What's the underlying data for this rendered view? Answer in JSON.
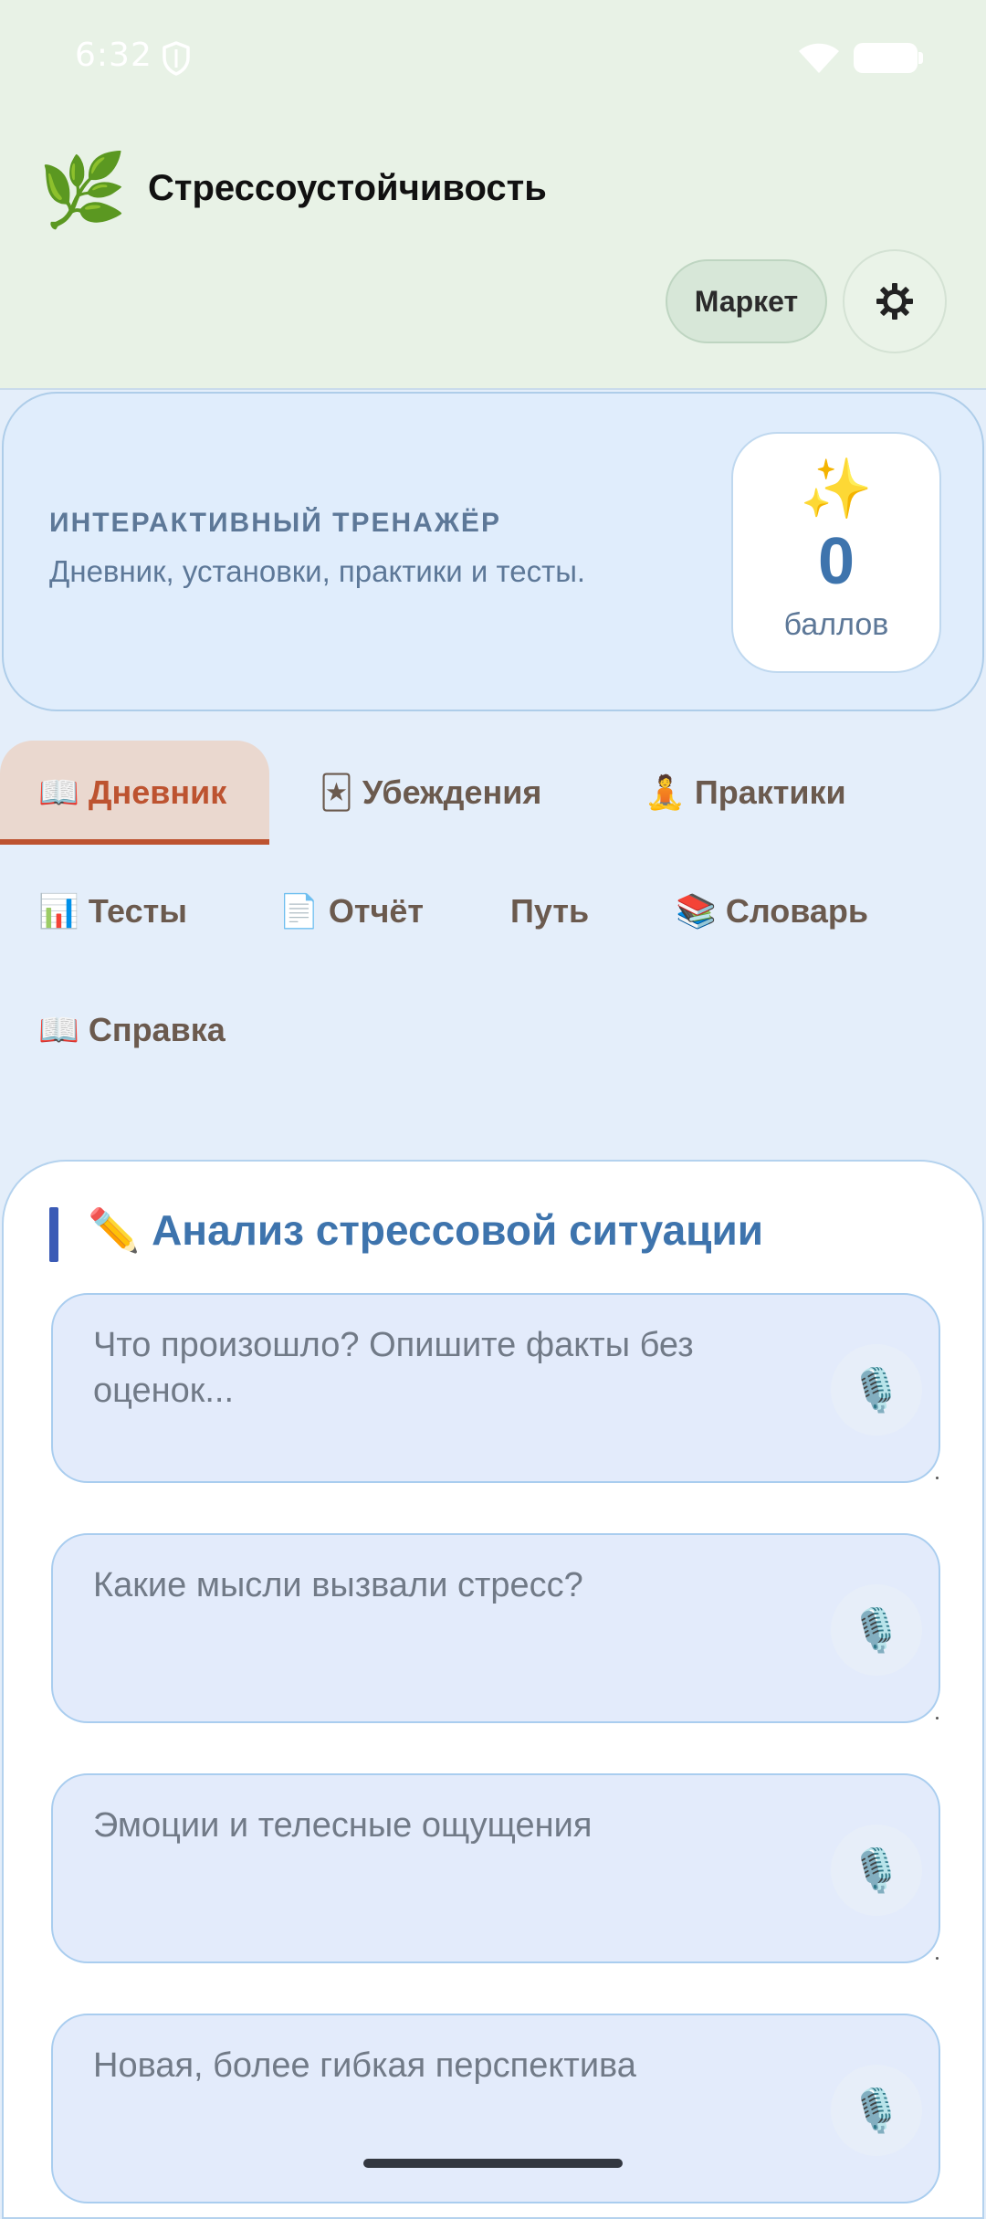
{
  "status_bar": {
    "time": "6:32"
  },
  "header": {
    "logo_icon": "🌿",
    "title": "Стрессоустойчивость",
    "market_label": "Маркет",
    "settings_icon": "gear-icon"
  },
  "hero": {
    "kicker": "ИНТЕРАКТИВНЫЙ ТРЕНАЖЁР",
    "subtitle": "Дневник, установки, практики и тесты.",
    "score_icon": "✨",
    "score_value": "0",
    "score_label": "баллов"
  },
  "tabs": [
    {
      "icon": "📖",
      "label": "Дневник",
      "active": true
    },
    {
      "icon": "🃏",
      "label": "Убеждения",
      "active": false
    },
    {
      "icon": "🧘",
      "label": "Практики",
      "active": false
    },
    {
      "icon": "📊",
      "label": "Тесты",
      "active": false
    },
    {
      "icon": "📄",
      "label": "Отчёт",
      "active": false
    },
    {
      "icon": "",
      "label": "Путь",
      "active": false
    },
    {
      "icon": "📚",
      "label": "Словарь",
      "active": false
    },
    {
      "icon": "📖",
      "label": "Справка",
      "active": false
    }
  ],
  "diary": {
    "title_icon": "✏️",
    "title": "Анализ стрессовой ситуации",
    "mic_icon": "🎙️",
    "fields": [
      {
        "placeholder": "Что произошло? Опишите факты без оценок...",
        "value": ""
      },
      {
        "placeholder": "Какие мысли вызвали стресс?",
        "value": ""
      },
      {
        "placeholder": "Эмоции и телесные ощущения",
        "value": ""
      },
      {
        "placeholder": "Новая, более гибкая перспектива",
        "value": ""
      }
    ]
  },
  "colors": {
    "header_bg": "#e8f2e6",
    "page_bg": "#e4eefa",
    "accent_blue": "#3e74ad",
    "active_tab": "#bd5330",
    "tab_text": "#6b5a4e"
  }
}
